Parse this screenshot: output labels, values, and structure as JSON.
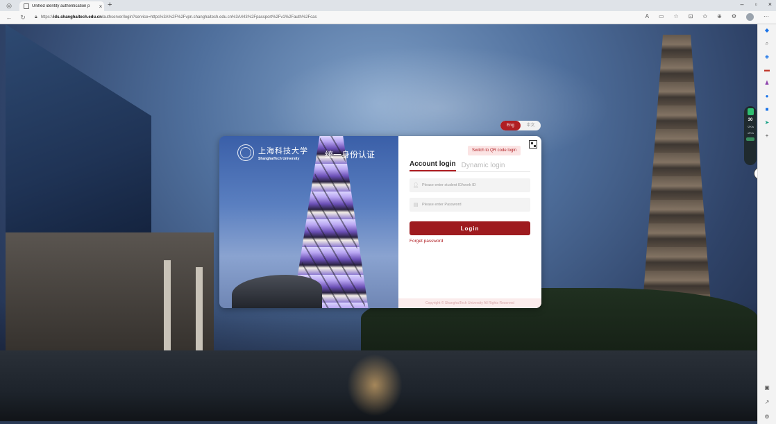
{
  "browser": {
    "tab_title": "Unified identity authentication p",
    "tab_close": "×",
    "new_tab": "+",
    "url_host": "ids.shanghaitech.edu.cn",
    "url_prefix": "https://",
    "url_rest": "/authserver/login?service=https%3A%2F%2Fvpn.shanghaitech.edu.cn%3A443%2Fpassport%2Fv1%2Fauth%2Fcas",
    "window_controls": [
      "–",
      "▫",
      "×"
    ]
  },
  "lang_toggle": {
    "active": "Eng",
    "inactive": "中文"
  },
  "card": {
    "university_cn": "上海科技大学",
    "university_en": "ShanghaiTech University",
    "system_title": "统一身份认证",
    "qr_switch": "Switch to QR code login",
    "tab_account": "Account login",
    "tab_dynamic": "Dynamic login",
    "username_placeholder": "Please enter student ID/work ID",
    "password_placeholder": "Please enter Password",
    "login_button": "Login",
    "forget_password": "Forget password",
    "copyright": "Copyright © ShanghaiTech University All Rights Reserved"
  },
  "widget": {
    "number": "30",
    "line1": "↑2K/s",
    "line2": "↓2K/s"
  },
  "colors": {
    "brand_red": "#b01e23",
    "button_red": "#9e1b1f"
  },
  "icons": {
    "qr": "qr-code-icon",
    "user": "user-icon",
    "lock": "lock-icon"
  }
}
